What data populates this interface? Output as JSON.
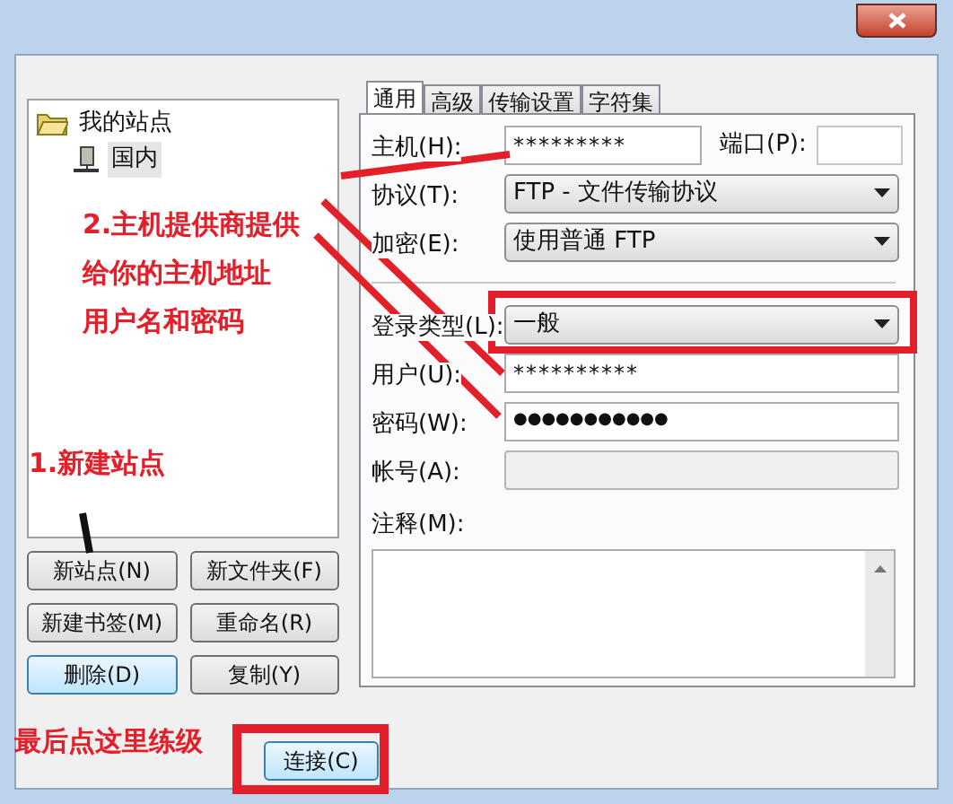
{
  "site_tree": [
    {
      "label": "我的站点",
      "selected": false,
      "children": [
        {
          "label": "国内",
          "selected": true
        }
      ]
    }
  ],
  "site_buttons": [
    {
      "label": "新站点(N)",
      "focused": false
    },
    {
      "label": "新文件夹(F)",
      "focused": false
    },
    {
      "label": "新建书签(M)",
      "focused": false
    },
    {
      "label": "重命名(R)",
      "focused": false
    },
    {
      "label": "删除(D)",
      "focused": true
    },
    {
      "label": "复制(Y)",
      "focused": false
    }
  ],
  "tabs": [
    {
      "label": "通用",
      "selected": true
    },
    {
      "label": "高级",
      "selected": false
    },
    {
      "label": "传输设置",
      "selected": false
    },
    {
      "label": "字符集",
      "selected": false
    }
  ],
  "fields": [
    {
      "kind": "text",
      "label": "主机(H):",
      "value": "*********",
      "port_label": "端口(P):"
    },
    {
      "kind": "select",
      "label": "协议(T):",
      "value": "FTP - 文件传输协议"
    },
    {
      "kind": "select",
      "label": "加密(E):",
      "value": "使用普通 FTP"
    },
    {
      "kind": "divider"
    },
    {
      "kind": "select",
      "label": "登录类型(L):",
      "value": "一般"
    },
    {
      "kind": "text",
      "label": "用户(U):",
      "value": "**********"
    },
    {
      "kind": "password",
      "label": "密码(W):",
      "value": "●●●●●●●●●●●"
    },
    {
      "kind": "disabled",
      "label": "帐号(A):"
    }
  ],
  "notes_label": "注释(M):",
  "connect_button": "连接(C)",
  "annotations": {
    "host_note": [
      "2.主机提供商提供",
      "给你的主机地址",
      "用户名和密码"
    ],
    "new_site_note": "1.新建站点",
    "connect_note": "最后点这里练级"
  }
}
